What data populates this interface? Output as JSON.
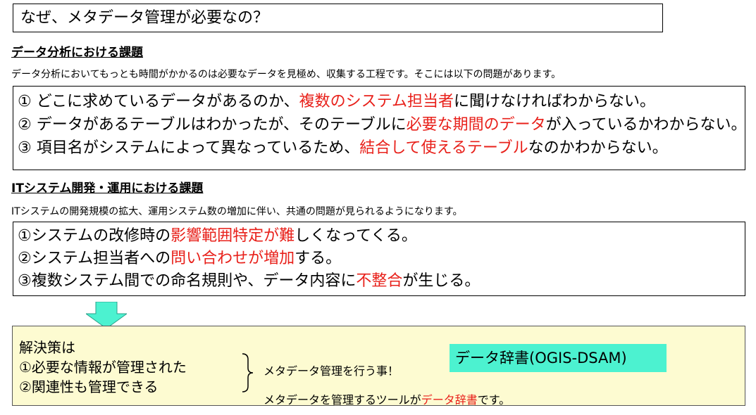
{
  "title": "なぜ、メタデータ管理が必要なの？",
  "analysis": {
    "heading": "データ分析における課題",
    "description": "データ分析においてもっとも時間がかかるのは必要なデータを見極め、収集する工程です。そこには以下の問題があります。",
    "items": [
      {
        "pre": "① どこに求めているデータがあるのか、",
        "highlight": "複数のシステム担当者",
        "post": "に聞けなければわからない。"
      },
      {
        "pre": "② データがあるテーブルはわかったが、そのテーブルに",
        "highlight": "必要な期間のデータ",
        "post": "が入っているかわからない。"
      },
      {
        "pre": "③ 項目名がシステムによって異なっているため、",
        "highlight": "結合して使えるテーブル",
        "post": "なのかわからない。"
      }
    ]
  },
  "it": {
    "heading": "ITシステム開発・運用における課題",
    "description": "ITシステムの開発規模の拡大、運用システム数の増加に伴い、共通の問題が見られるようになります。",
    "items": [
      {
        "pre": "①システムの改修時の",
        "highlight": "影響範囲特定が難",
        "post": "しくなってくる。"
      },
      {
        "pre": "②システム担当者への",
        "highlight": "問い合わせが増加",
        "post": "する。"
      },
      {
        "pre": "③複数システム間での命名規則や、データ内容に",
        "highlight": "不整合",
        "post": "が生じる。"
      }
    ]
  },
  "solution": {
    "lines": [
      "解決策は",
      "①必要な情報が管理された",
      "②関連性も管理できる"
    ],
    "brace_text": "メタデータ管理を行う事！",
    "tool_pre": "メタデータを管理するツールが",
    "tool_highlight": "データ辞書",
    "tool_post": "です。",
    "dict_label": "データ辞書(OGIS-DSAM)"
  },
  "colors": {
    "highlight": "#e8201a",
    "arrow_fill": "#4cf2d0",
    "solution_bg": "#fdfbd1",
    "dict_bg": "#4cf2d0"
  },
  "icons": {
    "arrow": "down-arrow-icon",
    "brace": "right-brace-icon"
  }
}
